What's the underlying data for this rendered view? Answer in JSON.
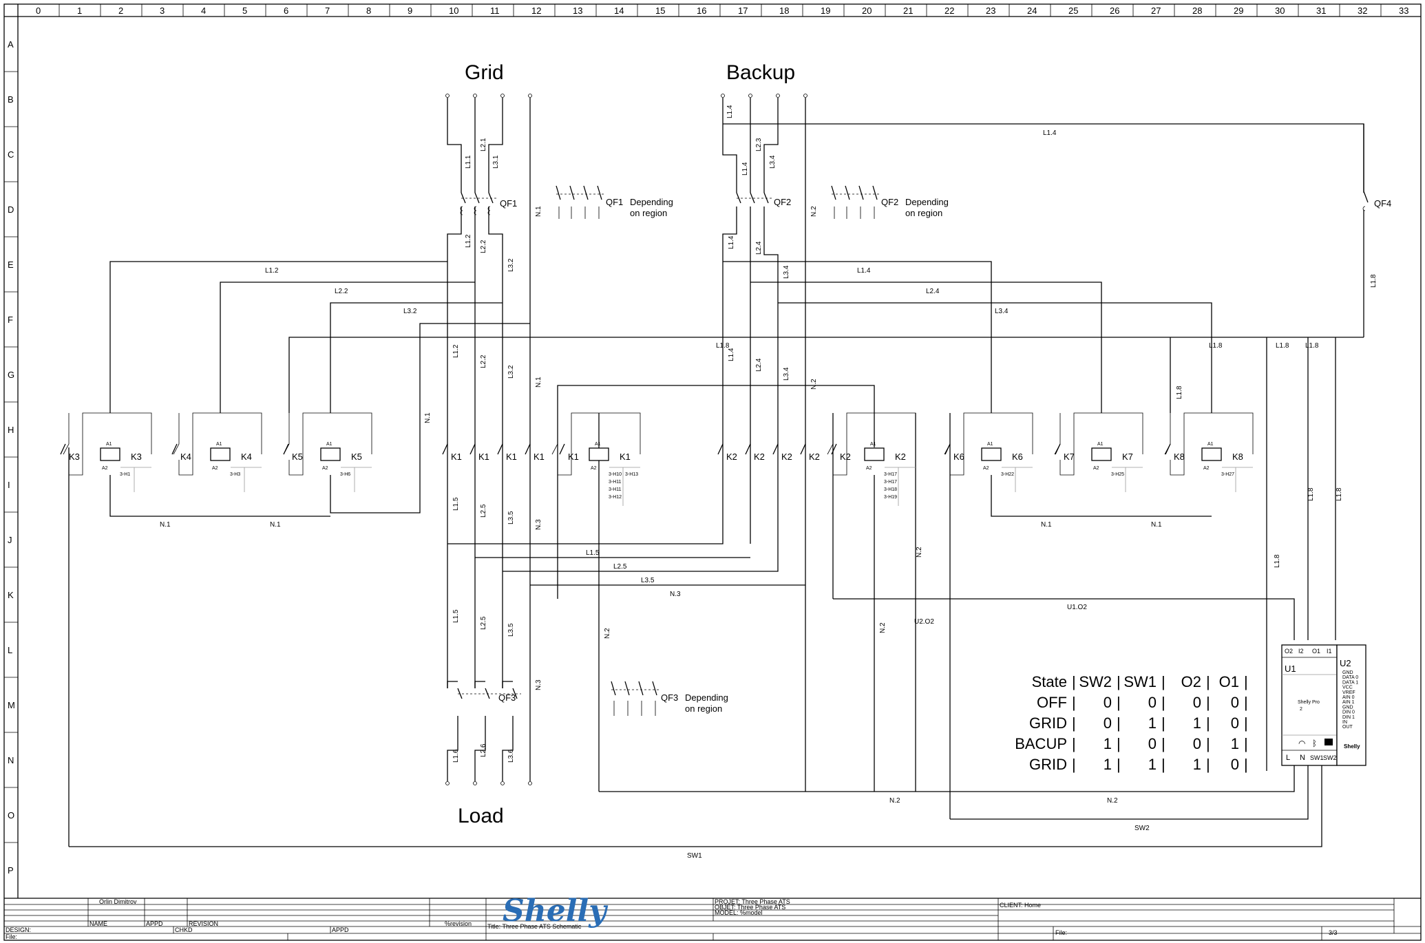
{
  "grid": {
    "columns": [
      "0",
      "1",
      "2",
      "3",
      "4",
      "5",
      "6",
      "7",
      "8",
      "9",
      "10",
      "11",
      "12",
      "13",
      "14",
      "15",
      "16",
      "17",
      "18",
      "19",
      "20",
      "21",
      "22",
      "23",
      "24",
      "25",
      "26",
      "27",
      "28",
      "29",
      "30",
      "31",
      "32",
      "33"
    ],
    "rows": [
      "A",
      "B",
      "C",
      "D",
      "E",
      "F",
      "G",
      "H",
      "I",
      "J",
      "K",
      "L",
      "M",
      "N",
      "O",
      "P"
    ]
  },
  "sources": {
    "grid_title": "Grid",
    "backup_title": "Backup",
    "load_title": "Load"
  },
  "breakers": {
    "qf1": "QF1",
    "qf2": "QF2",
    "qf3": "QF3",
    "qf4": "QF4",
    "depending_line1": "Depending",
    "depending_line2": "on region"
  },
  "wires": {
    "l1_1": "L1.1",
    "l2_1": "L2.1",
    "l3_1": "L3.1",
    "l1_2": "L1.2",
    "l2_2": "L2.2",
    "l3_2": "L3.2",
    "l1_4": "L1.4",
    "l2_3": "L2.3",
    "l3_4": "L3.4",
    "l2_4": "L2.4",
    "l1_5": "L1.5",
    "l2_5": "L2.5",
    "l3_5": "L3.5",
    "l1_6": "L1.6",
    "l2_6": "L2.6",
    "l3_6": "L3.6",
    "l1_8": "L1.8",
    "n1": "N.1",
    "n2": "N.2",
    "n3": "N.3",
    "u1o2": "U1.O2",
    "u2o2": "U2.O2",
    "sw1": "SW1",
    "sw2": "SW2"
  },
  "contactors": {
    "k1": "K1",
    "k2": "K2",
    "k3": "K3",
    "k4": "K4",
    "k5": "K5",
    "k6": "K6",
    "k7": "K7",
    "k8": "K8",
    "k3_ref": "3-H1",
    "k4_ref": "3-H3",
    "k5_ref": "3-H6",
    "k1_refs": [
      "3-H10",
      "3-H11",
      "3-H11",
      "3-H12"
    ],
    "k1_ref_b": "3-H13",
    "k2_refs": [
      "3-H17",
      "3-H17",
      "3-H18",
      "3-H19"
    ],
    "k6_ref": "3-H22",
    "k7_ref": "3-H25",
    "k8_ref": "3-H27",
    "a1": "A1",
    "a2": "A2"
  },
  "device": {
    "u1": "U1",
    "u2": "U2",
    "terminals_top": [
      "O2",
      "I2",
      "O1",
      "I1"
    ],
    "terminals_bottom": [
      "L",
      "N",
      "SW1",
      "SW2"
    ],
    "model_line1": "Shelly Pro",
    "model_line2": "2",
    "brand": "Shelly",
    "u2_pins": [
      "GND",
      "DATA 0",
      "DATA 1",
      "VCC",
      "VREF",
      "AIN 0",
      "AIN 1",
      "GND",
      "DIN 0",
      "DIN 1",
      "IN",
      "OUT"
    ]
  },
  "state_table": {
    "header": [
      "State",
      "SW2",
      "SW1",
      "O2",
      "O1"
    ],
    "rows": [
      [
        "OFF",
        "0",
        "0",
        "0",
        "0"
      ],
      [
        "GRID",
        "0",
        "1",
        "1",
        "0"
      ],
      [
        "BACUP",
        "1",
        "0",
        "0",
        "1"
      ],
      [
        "GRID",
        "1",
        "1",
        "1",
        "0"
      ]
    ]
  },
  "title_block": {
    "author": "Orlin Dimitrov",
    "name_label": "NAME",
    "appd_label": "APPD",
    "revision_label": "REVISION",
    "revision_value": "%revision",
    "design_label": "DESIGN:",
    "chkd_label": "CHKD",
    "appd_label2": "APPD",
    "file_label": "File:",
    "logo_text": "Shelly",
    "projet": "PROJET: Three Phase ATS",
    "objet": "OBJET: Three Phase ATS",
    "model": "MODEL: %model",
    "title": "Title: Three Phase ATS Schematic",
    "client": "CLIENT: Home",
    "file_label2": "File:",
    "page": "3/3"
  },
  "colors": {
    "ink": "#000000",
    "logo": "#2a6db5",
    "paper": "#ffffff"
  }
}
